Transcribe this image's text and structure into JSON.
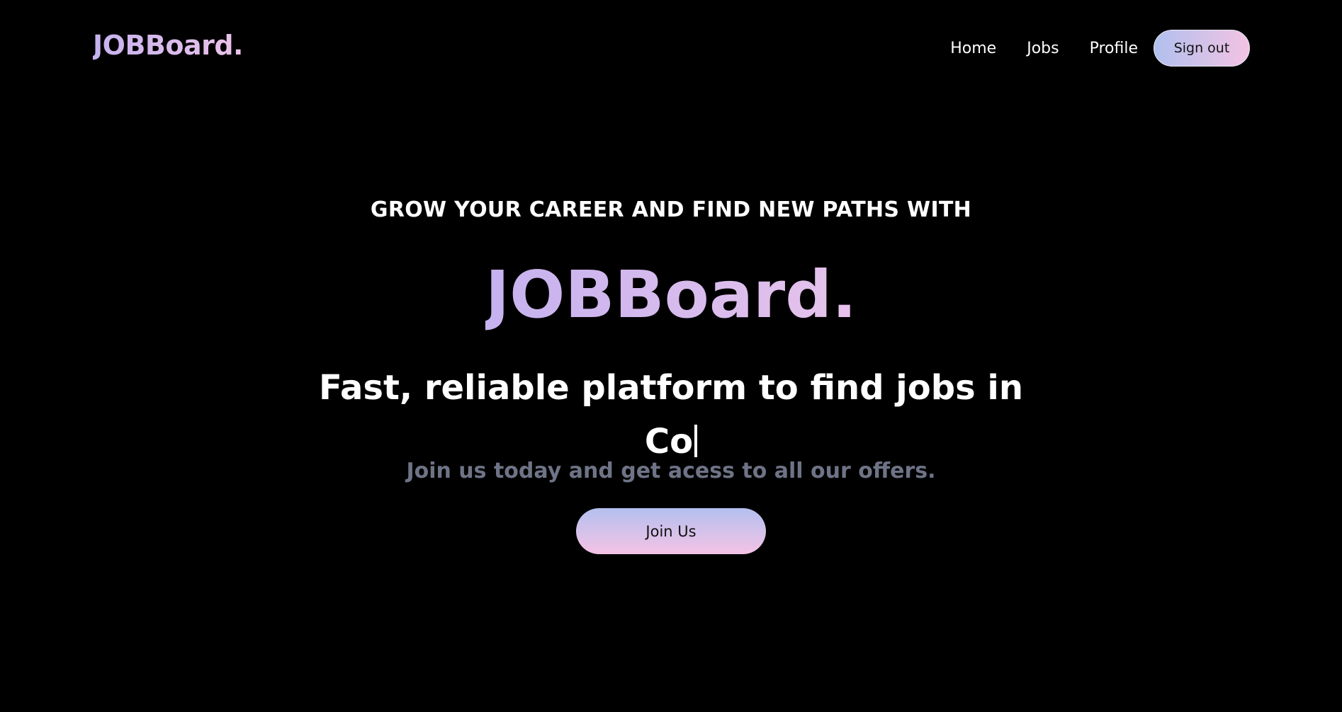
{
  "navbar": {
    "logo": "JOBBoard.",
    "links": {
      "home": "Home",
      "jobs": "Jobs",
      "profile": "Profile"
    },
    "signout_label": "Sign out"
  },
  "hero": {
    "tagline": "GROW YOUR CAREER AND FIND NEW PATHS WITH",
    "brand": "JOBBoard.",
    "subhead_line1": "Fast, reliable platform to find jobs in",
    "subhead_typed": "Co",
    "join_text": "Join us today and get acess to all our offers.",
    "join_button": "Join Us"
  },
  "colors": {
    "background": "#000000",
    "gradient_start": "#c5b2ee",
    "gradient_end": "#ecc3ea",
    "muted_text": "#6e7386"
  }
}
